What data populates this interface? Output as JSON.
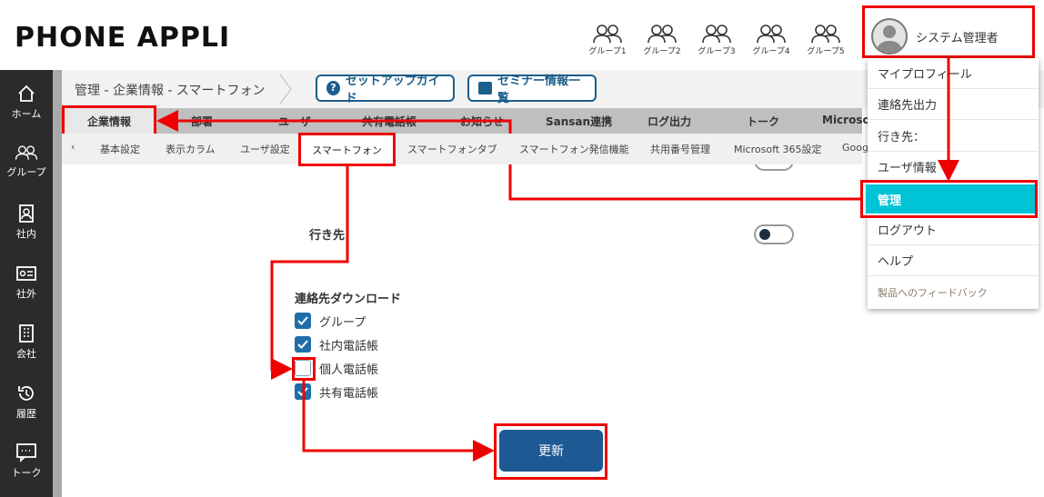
{
  "app": {
    "logo": "PHONE APPLI"
  },
  "header": {
    "groups": [
      "グループ1",
      "グループ2",
      "グループ3",
      "グループ4",
      "グループ5"
    ],
    "user_name": "システム管理者"
  },
  "sidebar": {
    "items": [
      {
        "label": "ホーム",
        "icon": "home-icon"
      },
      {
        "label": "グループ",
        "icon": "group-icon"
      },
      {
        "label": "社内",
        "icon": "contacts-book-icon"
      },
      {
        "label": "社外",
        "icon": "id-card-icon"
      },
      {
        "label": "会社",
        "icon": "building-icon"
      },
      {
        "label": "履歴",
        "icon": "history-icon"
      },
      {
        "label": "トーク",
        "icon": "chat-icon"
      }
    ]
  },
  "breadcrumb": {
    "text": "管理 - 企業情報 - スマートフォン"
  },
  "buttons": {
    "setup_guide": "セットアップガイド",
    "seminar": "セミナー情報一覧",
    "update": "更新"
  },
  "tabs": [
    "企業情報",
    "部署",
    "ユーザ",
    "共有電話帳",
    "お知らせ",
    "Sansan連携",
    "ログ出力",
    "トーク",
    "Microsoft"
  ],
  "subtabs": [
    "基本設定",
    "表示カラム",
    "ユーザ設定",
    "スマートフォン",
    "スマートフォンタブ",
    "スマートフォン発信機能",
    "共用番号管理",
    "Microsoft 365設定",
    "Goog"
  ],
  "content": {
    "destination_label": "行き先",
    "contact_download_title": "連絡先ダウンロード",
    "checkboxes": [
      {
        "label": "グループ",
        "checked": true
      },
      {
        "label": "社内電話帳",
        "checked": true
      },
      {
        "label": "個人電話帳",
        "checked": false
      },
      {
        "label": "共有電話帳",
        "checked": true
      }
    ]
  },
  "dropdown": {
    "items": [
      "マイプロフィール",
      "連絡先出力",
      "行き先：",
      "ユーザ情報",
      "管理",
      "ログアウト",
      "ヘルプ",
      "製品へのフィードバック"
    ]
  },
  "colors": {
    "annotation": "#e00000",
    "accent": "#00c4d6",
    "primary": "#1d5a94",
    "sidebar": "#2b2b2b"
  }
}
